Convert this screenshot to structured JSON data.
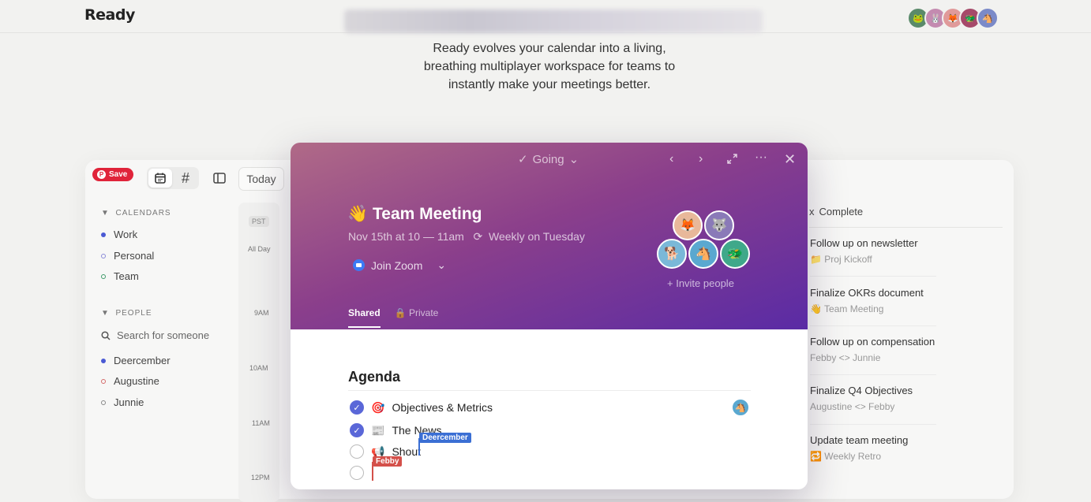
{
  "header": {
    "brand": "Ready",
    "avatars": [
      "🐸",
      "🐰",
      "🦊",
      "🐲",
      "🐴"
    ],
    "avatar_colors": [
      "#5a8a6a",
      "#c48bb0",
      "#e09a9a",
      "#a64a6a",
      "#7b8ac8"
    ]
  },
  "tagline": {
    "line1": "Ready evolves your calendar into a living,",
    "line2": "breathing multiplayer workspace for teams to",
    "line3": "instantly make your meetings better."
  },
  "pinterest": {
    "save_label": "Save"
  },
  "toolbar": {
    "today_label": "Today",
    "hash_label": "#"
  },
  "sidebar": {
    "calendars_heading": "CALENDARS",
    "calendars": [
      {
        "label": "Work",
        "color": "#4a5ad4"
      },
      {
        "label": "Personal",
        "color": "#8a8ad8"
      },
      {
        "label": "Team",
        "color": "#3f9a6a"
      }
    ],
    "people_heading": "PEOPLE",
    "search_placeholder": "Search for someone",
    "people": [
      {
        "label": "Deercember",
        "color": "#4a5ad4"
      },
      {
        "label": "Augustine",
        "color": "#d46a6a"
      },
      {
        "label": "Junnie",
        "color": "#888888"
      }
    ]
  },
  "timeline": {
    "tz": "PST",
    "all_day": "All Day",
    "hours": [
      "9AM",
      "10AM",
      "11AM",
      "12PM"
    ]
  },
  "meeting": {
    "status": "Going",
    "title": "Team Meeting",
    "title_emoji": "👋",
    "time": "Nov 15th at 10 — 11am",
    "recurrence": "Weekly on Tuesday",
    "zoom_label": "Join Zoom",
    "invite_label": "+ Invite people",
    "attendees": [
      "🦊",
      "🐺",
      "🐕",
      "🐴",
      "🐲"
    ],
    "attendee_colors": [
      "#e8b89a",
      "#8a7ab8",
      "#7ab8d8",
      "#5aa8d0",
      "#3fa88a"
    ],
    "tab_shared": "Shared",
    "tab_private": "Private",
    "agenda_heading": "Agenda",
    "agenda": [
      {
        "emoji": "🎯",
        "label": "Objectives & Metrics",
        "done": true
      },
      {
        "emoji": "📰",
        "label": "The News",
        "done": true
      },
      {
        "emoji": "📢",
        "label": "Shout",
        "done": false
      },
      {
        "emoji": "",
        "label": "",
        "done": false
      }
    ],
    "cursor_deercember": "Deercember",
    "cursor_febby": "Febby",
    "cursor_deercember_color": "#3b6fd4",
    "cursor_febby_color": "#d4504a"
  },
  "todos": {
    "tab_inbox": "x",
    "tab_complete": "Complete",
    "items": [
      {
        "title": "Follow up on newsletter",
        "sub": "📁 Proj Kickoff"
      },
      {
        "title": "Finalize OKRs document",
        "sub": "👋 Team Meeting"
      },
      {
        "title": "Follow up on compensation",
        "sub": "Febby <> Junnie"
      },
      {
        "title": "Finalize Q4 Objectives",
        "sub": "Augustine <> Febby"
      },
      {
        "title": "Update team meeting",
        "sub": "🔁 Weekly Retro"
      }
    ]
  }
}
